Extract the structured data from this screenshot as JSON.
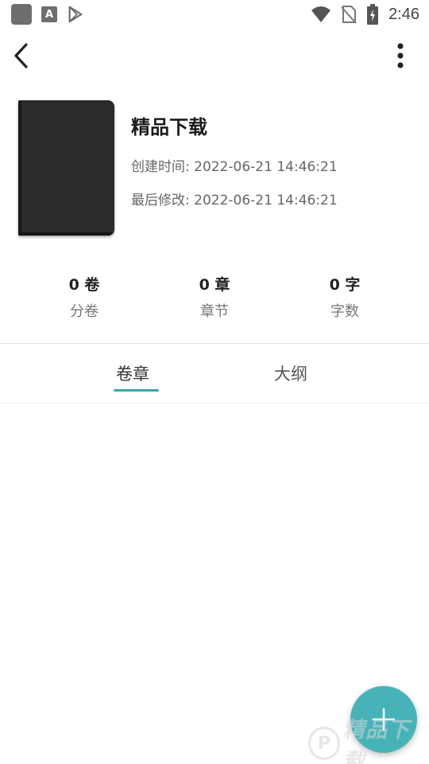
{
  "status_bar": {
    "time": "2:46",
    "left_icons": [
      "app-square-icon",
      "a-notification-icon",
      "play-store-icon"
    ],
    "right_icons": [
      "wifi-icon",
      "no-sim-icon",
      "battery-charging-icon"
    ]
  },
  "app_bar": {
    "back_icon": "chevron-left-icon",
    "more_icon": "more-vertical-icon"
  },
  "book": {
    "title": "精品下载",
    "created": "创建时间: 2022-06-21 14:46:21",
    "modified": "最后修改: 2022-06-21 14:46:21"
  },
  "stats": {
    "volumes": {
      "value": "0 卷",
      "label": "分卷"
    },
    "chapters": {
      "value": "0 章",
      "label": "章节"
    },
    "words": {
      "value": "0 字",
      "label": "字数"
    }
  },
  "tabs": [
    {
      "label": "卷章",
      "active": true
    },
    {
      "label": "大纲",
      "active": false
    }
  ],
  "fab": {
    "icon": "plus-icon"
  },
  "watermark": {
    "text": "精品下载"
  },
  "colors": {
    "accent": "#3aa7ad",
    "fab": "#47b3b8",
    "cover": "#2b2b2b"
  }
}
